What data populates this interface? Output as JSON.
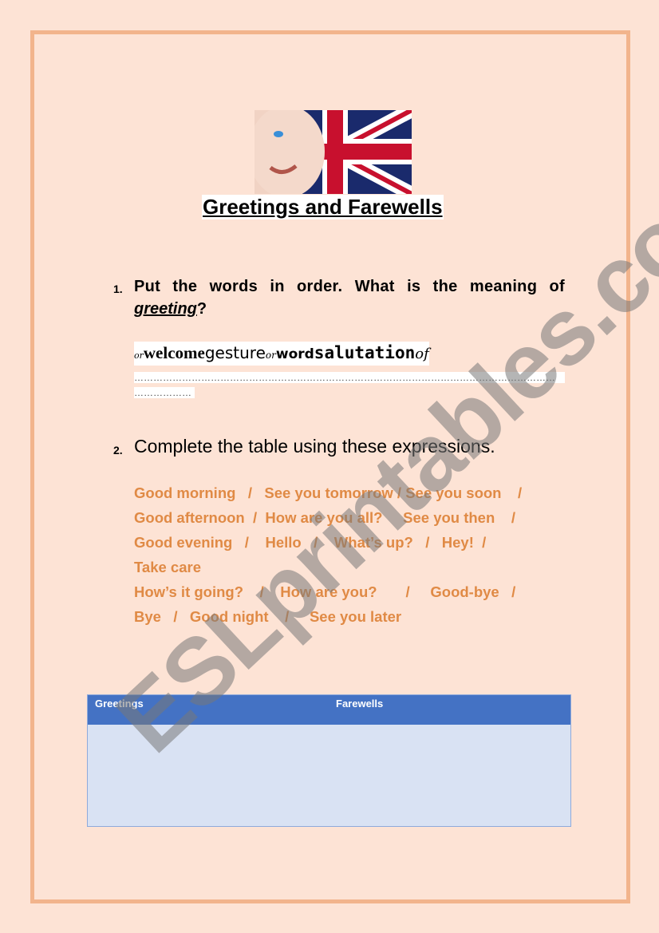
{
  "title": "Greetings and Farewells",
  "q1": {
    "number": "1.",
    "text": "Put the words in order. What is the meaning of",
    "keyword": "greeting",
    "end": "?",
    "scrambled": [
      "or",
      "welcome",
      "gesture",
      "or",
      "word",
      "salutation",
      "of"
    ],
    "answer_line1": "……………………………………………………………………………………………………………………",
    "answer_line2": "………………"
  },
  "q2": {
    "number": "2.",
    "text": "Complete the table using these expressions."
  },
  "expressions": [
    "Good morning   /   See you tomorrow / See you soon    /",
    "Good afternoon  /  How are you all?     See you then    /",
    "Good evening   /    Hello   /    What’s up?   /   Hey!  /",
    "Take care",
    "How’s it going?    /    How are you?       /     Good-bye   /",
    "Bye   /   Good night    /     See you later"
  ],
  "table": {
    "headers": [
      "Greetings",
      "Farewells"
    ]
  },
  "watermark": "ESLprintables.com",
  "colors": {
    "expressions": "#e08a45",
    "table_header": "#4472c4",
    "table_body": "#d9e2f3",
    "border": "#f2b48c"
  }
}
